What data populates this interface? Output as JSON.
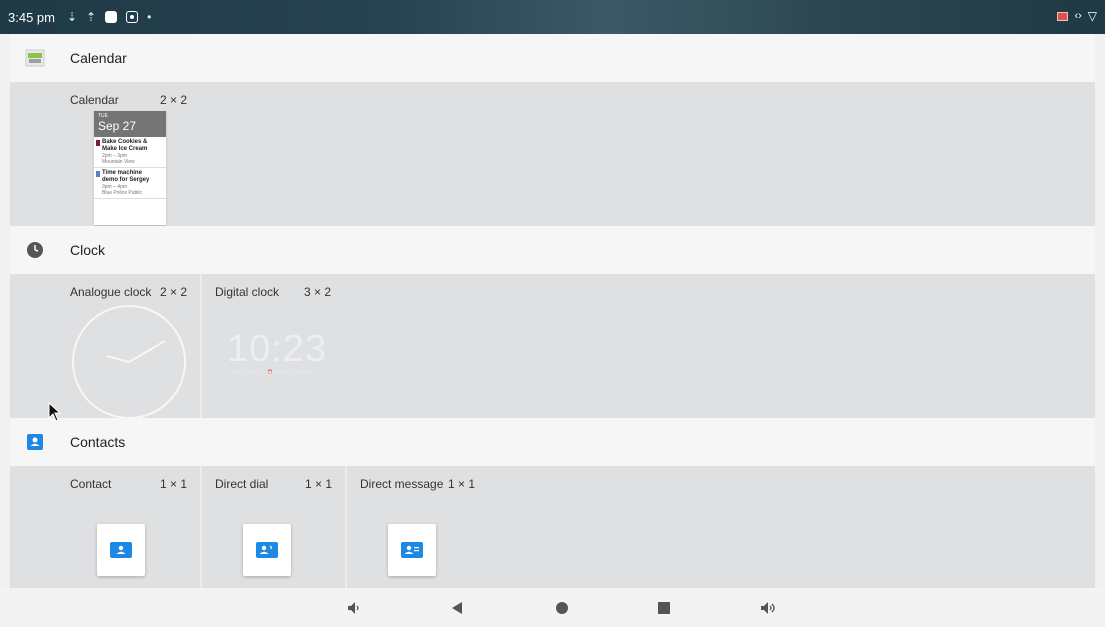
{
  "status_bar": {
    "time": "3:45 pm"
  },
  "sections": {
    "calendar": {
      "title": "Calendar",
      "widgets": [
        {
          "name": "Calendar",
          "size": "2 × 2"
        }
      ],
      "preview": {
        "day": "TUE",
        "date": "Sep 27",
        "events": [
          {
            "title_line1": "Bake Cookies &",
            "title_line2": "Make Ice Cream",
            "time": "2pm – 3pm",
            "location": "Mountain View",
            "color": "#7b1f2a"
          },
          {
            "title_line1": "Time machine",
            "title_line2": "demo for Sergey",
            "time": "3pm – 4pm",
            "location": "Blue Police Public",
            "color": "#5b7fc3"
          }
        ]
      }
    },
    "clock": {
      "title": "Clock",
      "widgets": [
        {
          "name": "Analogue clock",
          "size": "2 × 2"
        },
        {
          "name": "Digital clock",
          "size": "3 × 2"
        }
      ],
      "digital_time": "10:23",
      "digital_subtext": "TUE, MAR 27 ⏰ WED, 8:00 AM"
    },
    "contacts": {
      "title": "Contacts",
      "widgets": [
        {
          "name": "Contact",
          "size": "1 × 1"
        },
        {
          "name": "Direct dial",
          "size": "1 × 1"
        },
        {
          "name": "Direct message",
          "size": "1 × 1"
        }
      ]
    }
  },
  "colors": {
    "accent": "#1e88e5",
    "panel": "#dfe0e2",
    "header": "#f6f6f6"
  }
}
